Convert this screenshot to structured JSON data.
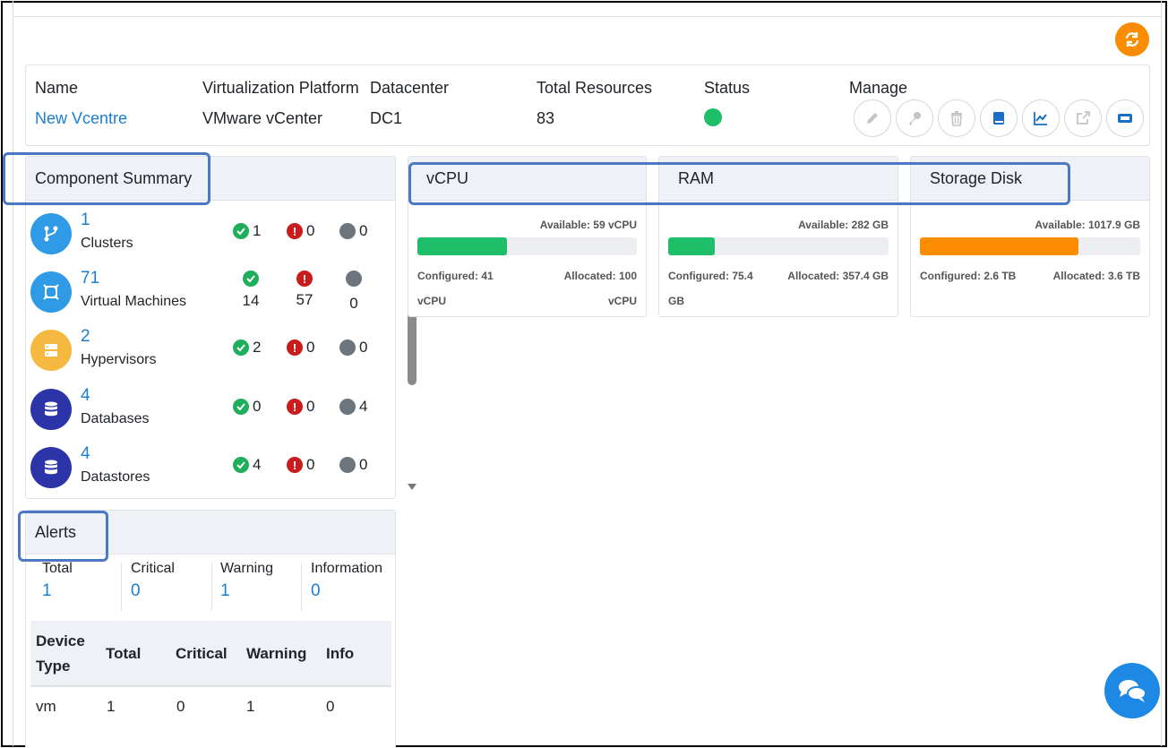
{
  "info": {
    "headers": {
      "name": "Name",
      "platform": "Virtualization Platform",
      "datacenter": "Datacenter",
      "total": "Total Resources",
      "status": "Status",
      "manage": "Manage"
    },
    "values": {
      "name": "New Vcentre",
      "platform": "VMware vCenter",
      "datacenter": "DC1",
      "total": "83"
    },
    "status_color": "#1fbf6a",
    "manage_icons": [
      "pencil-icon",
      "key-icon",
      "trash-icon",
      "book-icon",
      "chart-icon",
      "external-link-icon",
      "ticket-icon"
    ]
  },
  "component_summary": {
    "title": "Component Summary",
    "items": [
      {
        "count": "1",
        "name": "Clusters",
        "ok": "1",
        "critical": "0",
        "unknown": "0",
        "icon": "cluster-icon",
        "color": "#2f9be6"
      },
      {
        "count": "71",
        "name": "Virtual Machines",
        "ok": "14",
        "critical": "57",
        "unknown": "0",
        "icon": "vm-icon",
        "color": "#2f9be6"
      },
      {
        "count": "2",
        "name": "Hypervisors",
        "ok": "2",
        "critical": "0",
        "unknown": "0",
        "icon": "server-icon",
        "color": "#f5b942"
      },
      {
        "count": "4",
        "name": "Databases",
        "ok": "0",
        "critical": "0",
        "unknown": "4",
        "icon": "database-icon",
        "color": "#2b35a8"
      },
      {
        "count": "4",
        "name": "Datastores",
        "ok": "4",
        "critical": "0",
        "unknown": "0",
        "icon": "datastore-icon",
        "color": "#2b35a8"
      }
    ]
  },
  "resources": [
    {
      "title": "vCPU",
      "available": "Available: 59 vCPU",
      "configured": "Configured: 41",
      "allocated": "Allocated: 100",
      "unit_left": "vCPU",
      "unit_right": "vCPU",
      "fill_percent": 41,
      "color": "#1fbf6a"
    },
    {
      "title": "RAM",
      "available": "Available: 282 GB",
      "configured": "Configured: 75.4",
      "allocated": "Allocated: 357.4 GB",
      "unit_left": "GB",
      "unit_right": "",
      "fill_percent": 21,
      "color": "#1fbf6a"
    },
    {
      "title": "Storage Disk",
      "available": "Available: 1017.9 GB",
      "configured": "Configured: 2.6 TB",
      "allocated": "Allocated: 3.6 TB",
      "unit_left": "",
      "unit_right": "",
      "fill_percent": 72,
      "color": "#fb8c00"
    }
  ],
  "alerts": {
    "title": "Alerts",
    "summary": [
      {
        "label": "Total",
        "value": "1"
      },
      {
        "label": "Critical",
        "value": "0"
      },
      {
        "label": "Warning",
        "value": "1"
      },
      {
        "label": "Information",
        "value": "0"
      }
    ],
    "table": {
      "headers": {
        "device_type_1": "Device",
        "device_type_2": "Type",
        "total": "Total",
        "critical": "Critical",
        "warning": "Warning",
        "info": "Info"
      },
      "rows": [
        {
          "device": "vm",
          "total": "1",
          "critical": "0",
          "warning": "1",
          "info": "0"
        }
      ]
    }
  },
  "colors": {
    "accent": "#1a7fd1",
    "highlight": "#4a78c2",
    "refresh": "#fb8c00",
    "chat": "#1e88e5"
  }
}
